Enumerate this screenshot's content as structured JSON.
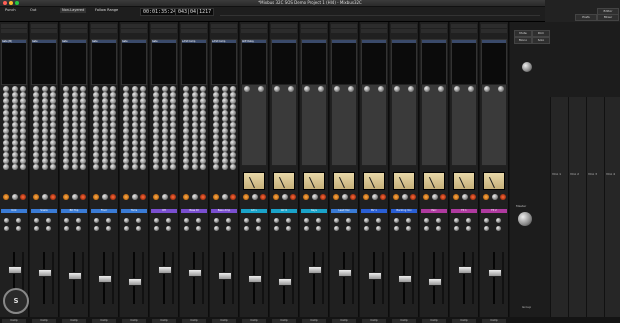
{
  "window_title": "*Mixbus 32C SOS Demo Project 1 (Hl4) - Mixbus32C",
  "transport": {
    "labels": [
      "Punch",
      "Out",
      "Follow Range"
    ],
    "mode": "Non-Layered",
    "clock_primary": "00:01:35:24",
    "clock_secondary": "043|04|1217",
    "right_buttons": [
      "Editor",
      "Mixer",
      "Prefs"
    ]
  },
  "channels": [
    {
      "name": "Kick",
      "insert": "Gate (M)",
      "color": "#3a7bd5"
    },
    {
      "name": "Snare",
      "insert": "Gate",
      "color": "#3a7bd5"
    },
    {
      "name": "BD Top",
      "insert": "Gate",
      "color": "#3a7bd5"
    },
    {
      "name": "Floor",
      "insert": "Gate",
      "color": "#3a7bd5"
    },
    {
      "name": "Toms",
      "insert": "Gate",
      "color": "#3a7bd5"
    },
    {
      "name": "OH",
      "insert": "Gate",
      "color": "#7a4fd0"
    },
    {
      "name": "Bass DI",
      "insert": "a-Ext Comp",
      "color": "#7a4fd0"
    },
    {
      "name": "Bass Amp",
      "insert": "a-Ext Comp",
      "color": "#7a4fd0"
    },
    {
      "name": "Gtr L",
      "insert": "ACE Delay",
      "color": "#1aa3c9"
    },
    {
      "name": "Gtr R",
      "insert": "",
      "color": "#1aa3c9"
    },
    {
      "name": "Keys",
      "insert": "",
      "color": "#1aa3c9"
    },
    {
      "name": "Lead Vox",
      "insert": "",
      "color": "#3a7bd5"
    },
    {
      "name": "BV 1",
      "insert": "",
      "color": "#2a5fd5"
    },
    {
      "name": "Backing Vox",
      "insert": "",
      "color": "#2a5fd5"
    },
    {
      "name": "Perc",
      "insert": "",
      "color": "#b03aa0"
    },
    {
      "name": "FX 1",
      "insert": "",
      "color": "#b03aa0"
    },
    {
      "name": "FX 2",
      "insert": "",
      "color": "#b03aa0"
    }
  ],
  "channel_mode_label": "Comp",
  "channel_bottom_label": "Comp",
  "monitor": {
    "buttons": [
      "Mute",
      "Dim",
      "Mono",
      "Solo"
    ],
    "label": "Master",
    "vca_labels": [
      "VCA 1",
      "VCA 2",
      "VCA 3",
      "VCA 4"
    ],
    "footer": "Group"
  },
  "logo_text": "SOS"
}
